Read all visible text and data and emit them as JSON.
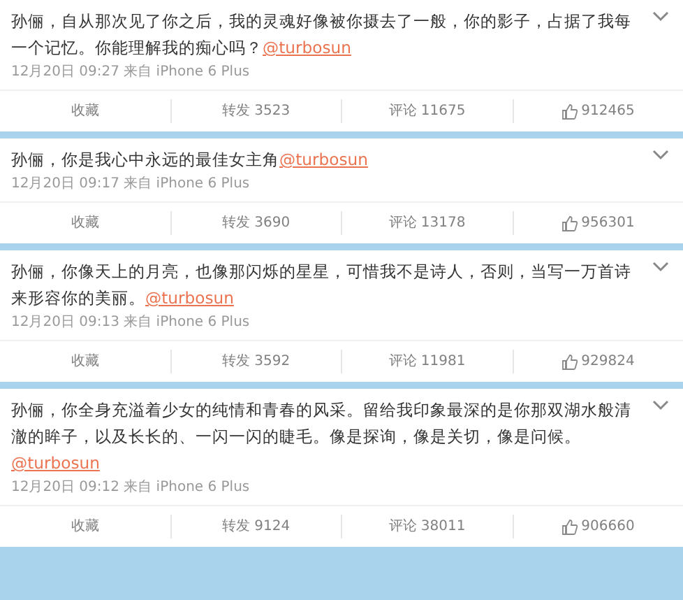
{
  "posts": [
    {
      "text": "孙俪，自从那次见了你之后，我的灵魂好像被你摄去了一般，你的影子，占据了我每一个记忆。你能理解我的痴心吗？",
      "mention": "@turbosun",
      "meta": "12月20日 09:27 来自 iPhone 6 Plus",
      "actions": {
        "favorite": "收藏",
        "repost": "转发 3523",
        "comment": "评论 11675",
        "likes": "912465"
      }
    },
    {
      "text": "孙俪，你是我心中永远的最佳女主角",
      "mention": "@turbosun",
      "meta": "12月20日 09:17 来自 iPhone 6 Plus",
      "actions": {
        "favorite": "收藏",
        "repost": "转发 3690",
        "comment": "评论 13178",
        "likes": "956301"
      }
    },
    {
      "text": "孙俪，你像天上的月亮，也像那闪烁的星星，可惜我不是诗人，否则，当写一万首诗来形容你的美丽。",
      "mention": "@turbosun",
      "meta": "12月20日 09:13 来自 iPhone 6 Plus",
      "actions": {
        "favorite": "收藏",
        "repost": "转发 3592",
        "comment": "评论 11981",
        "likes": "929824"
      }
    },
    {
      "text": "孙俪，你全身充溢着少女的纯情和青春的风采。留给我印象最深的是你那双湖水般清澈的眸子，以及长长的、一闪一闪的睫毛。像是探询，像是关切，像是问候。",
      "mention": "@turbosun",
      "meta": "12月20日 09:12 来自 iPhone 6 Plus",
      "actions": {
        "favorite": "收藏",
        "repost": "转发 9124",
        "comment": "评论 38011",
        "likes": "906660"
      }
    }
  ]
}
